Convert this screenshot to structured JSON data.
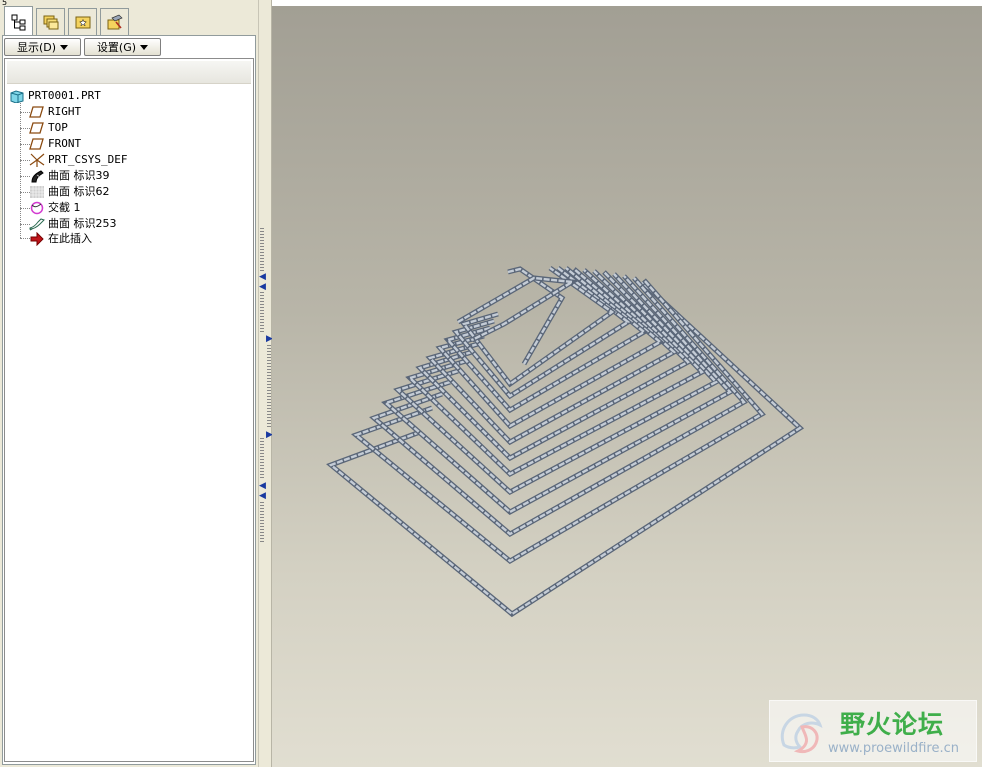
{
  "window": {
    "corner_mark": "5"
  },
  "tabs": [
    {
      "name": "model-tree-tab",
      "icon": "model-tree-icon",
      "active": true
    },
    {
      "name": "folder-browser-tab",
      "icon": "folder-browser-icon",
      "active": false
    },
    {
      "name": "favorites-tab",
      "icon": "favorites-icon",
      "active": false
    },
    {
      "name": "connections-tab",
      "icon": "connections-icon",
      "active": false
    }
  ],
  "toolbar": {
    "display_label": "显示(D)",
    "settings_label": "设置(G)"
  },
  "tree": {
    "root": {
      "label": "PRT0001.PRT",
      "icon": "part-icon"
    },
    "items": [
      {
        "label": "RIGHT",
        "icon": "datum-plane-icon"
      },
      {
        "label": "TOP",
        "icon": "datum-plane-icon"
      },
      {
        "label": "FRONT",
        "icon": "datum-plane-icon"
      },
      {
        "label": "PRT_CSYS_DEF",
        "icon": "coordinate-system-icon"
      },
      {
        "label": "曲面 标识39",
        "icon": "surface-icon"
      },
      {
        "label": "曲面 标识62",
        "icon": "surface-grid-icon"
      },
      {
        "label": "交截 1",
        "icon": "intersect-icon"
      },
      {
        "label": "曲面 标识253",
        "icon": "sweep-surface-icon"
      },
      {
        "label": "在此插入",
        "icon": "insert-here-arrow-icon"
      }
    ]
  },
  "watermark": {
    "title": "野火论坛",
    "url": "www.proewildfire.cn"
  },
  "colors": {
    "panel_bg": "#ece9d8",
    "viewport_top": "#a29f94",
    "viewport_bottom": "#e1ded1",
    "tube_fill": "#c4ccd6",
    "tube_edge": "#5a6678",
    "watermark_green": "#3fae4a"
  }
}
